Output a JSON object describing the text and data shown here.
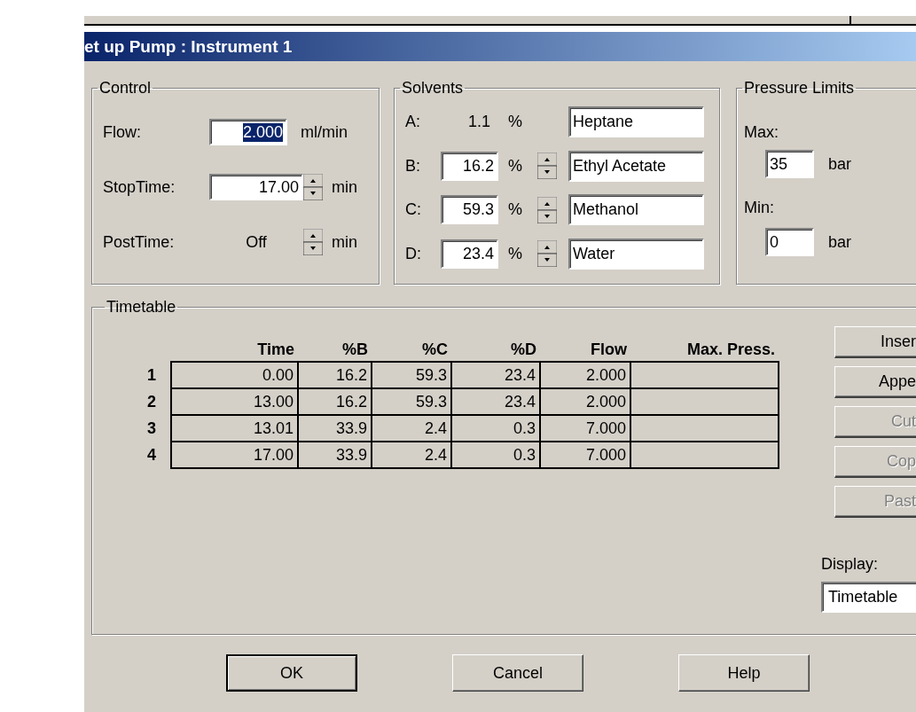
{
  "window": {
    "title": "et up Pump : Instrument 1"
  },
  "control": {
    "title": "Control",
    "fields": [
      {
        "kind": "input",
        "label": "Flow:",
        "value": "2.000",
        "value_selected": true,
        "unit": "ml/min"
      },
      {
        "kind": "spin",
        "label": "StopTime:",
        "value": "17.00",
        "value_selected": false,
        "unit": "min"
      },
      {
        "kind": "readout",
        "label": "PostTime:",
        "value": "Off",
        "value_selected": false,
        "unit": "min"
      }
    ]
  },
  "solvents": {
    "title": "Solvents",
    "rows": [
      {
        "kind": "fixed",
        "channel": "A:",
        "percent": "1.1",
        "unit": "%",
        "name": "Heptane"
      },
      {
        "kind": "spin",
        "channel": "B:",
        "percent": "16.2",
        "unit": "%",
        "name": "Ethyl Acetate"
      },
      {
        "kind": "spin",
        "channel": "C:",
        "percent": "59.3",
        "unit": "%",
        "name": "Methanol"
      },
      {
        "kind": "spin",
        "channel": "D:",
        "percent": "23.4",
        "unit": "%",
        "name": "Water"
      }
    ]
  },
  "pressure_limits": {
    "title": "Pressure Limits",
    "limits": [
      {
        "label": "Max:",
        "value": "35",
        "unit": "bar"
      },
      {
        "label": "Min:",
        "value": "0",
        "unit": "bar"
      }
    ]
  },
  "timetable": {
    "title": "Timetable",
    "columns": [
      "Time",
      "%B",
      "%C",
      "%D",
      "Flow",
      "Max. Press."
    ],
    "rows": [
      {
        "number": "1",
        "cells": [
          "0.00",
          "16.2",
          "59.3",
          "23.4",
          "2.000"
        ]
      },
      {
        "number": "2",
        "cells": [
          "13.00",
          "16.2",
          "59.3",
          "23.4",
          "2.000"
        ]
      },
      {
        "number": "3",
        "cells": [
          "13.01",
          "33.9",
          "2.4",
          "0.3",
          "7.000"
        ]
      },
      {
        "number": "4",
        "cells": [
          "17.00",
          "33.9",
          "2.4",
          "0.3",
          "7.000"
        ]
      }
    ],
    "buttons": [
      {
        "label": "Inser",
        "disabled": false
      },
      {
        "label": "Appe",
        "disabled": false
      },
      {
        "label": "Cut",
        "disabled": true
      },
      {
        "label": "Cop",
        "disabled": true
      },
      {
        "label": "Past",
        "disabled": true
      }
    ],
    "display": {
      "label": "Display:",
      "value": "Timetable"
    }
  },
  "footer_buttons": [
    {
      "label": "OK",
      "default": true
    },
    {
      "label": "Cancel",
      "default": false
    },
    {
      "label": "Help",
      "default": false
    }
  ]
}
